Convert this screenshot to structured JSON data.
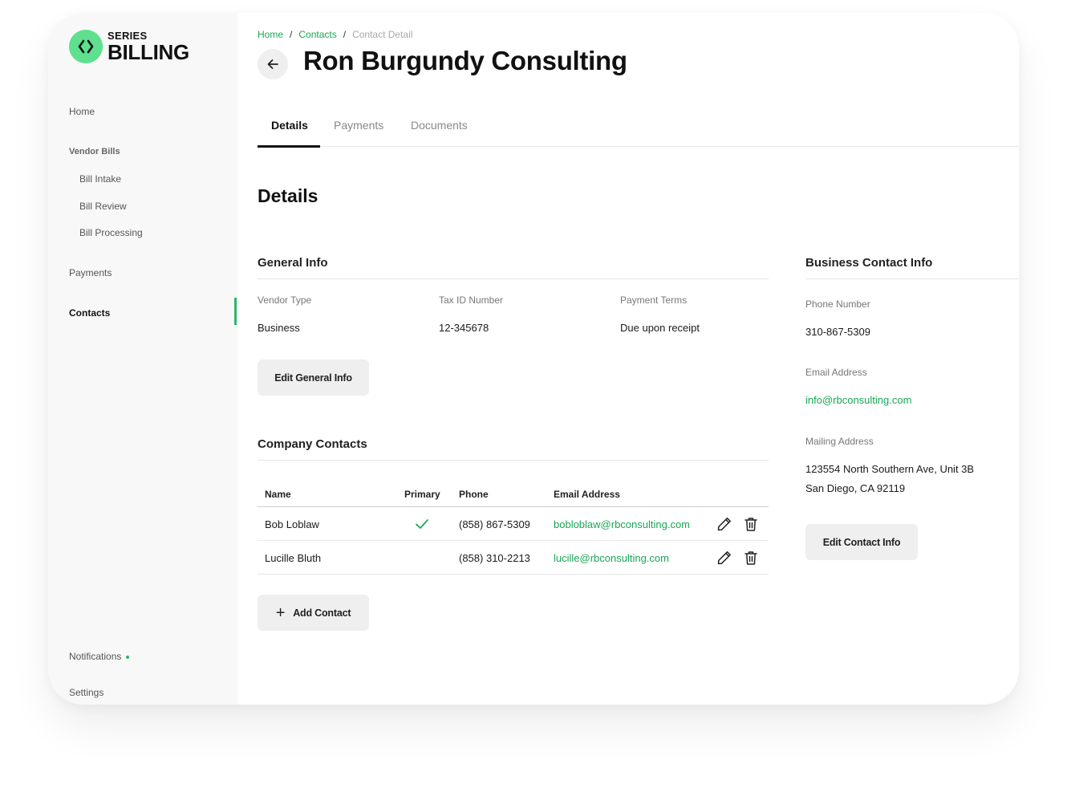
{
  "brand": {
    "series": "SERIES",
    "billing": "BILLING",
    "accent": "#5ee08e"
  },
  "sidebar": {
    "home": "Home",
    "vendor_bills": "Vendor Bills",
    "bill_intake": "Bill Intake",
    "bill_review": "Bill Review",
    "bill_processing": "Bill Processing",
    "payments": "Payments",
    "contacts": "Contacts",
    "notifications": "Notifications",
    "settings": "Settings"
  },
  "breadcrumb": {
    "home": "Home",
    "contacts": "Contacts",
    "current": "Contact Detail",
    "sep": "/"
  },
  "page": {
    "title": "Ron Burgundy Consulting",
    "back_icon": "arrow-left-icon"
  },
  "tabs": [
    {
      "label": "Details",
      "active": true
    },
    {
      "label": "Payments",
      "active": false
    },
    {
      "label": "Documents",
      "active": false
    }
  ],
  "details": {
    "heading": "Details",
    "general_info": {
      "title": "General Info",
      "vendor_type_label": "Vendor Type",
      "vendor_type": "Business",
      "tax_id_label": "Tax ID Number",
      "tax_id": "12-345678",
      "payment_terms_label": "Payment Terms",
      "payment_terms": "Due upon receipt",
      "edit_button": "Edit General Info"
    },
    "company_contacts": {
      "title": "Company Contacts",
      "columns": {
        "name": "Name",
        "primary": "Primary",
        "phone": "Phone",
        "email": "Email Address"
      },
      "rows": [
        {
          "name": "Bob Loblaw",
          "primary": true,
          "phone": "(858) 867-5309",
          "email": "bobloblaw@rbconsulting.com"
        },
        {
          "name": "Lucille Bluth",
          "primary": false,
          "phone": "(858) 310-2213",
          "email": "lucille@rbconsulting.com"
        }
      ],
      "add_button": "Add Contact"
    },
    "business_contact": {
      "title": "Business Contact Info",
      "phone_label": "Phone Number",
      "phone": "310-867-5309",
      "email_label": "Email Address",
      "email": "info@rbconsulting.com",
      "mailing_label": "Mailing Address",
      "address_line1": "123554 North Southern Ave, Unit 3B",
      "address_line2": "San Diego, CA 92119",
      "edit_button": "Edit Contact Info"
    }
  },
  "colors": {
    "link": "#1aa654",
    "active_indicator": "#2cb866"
  }
}
